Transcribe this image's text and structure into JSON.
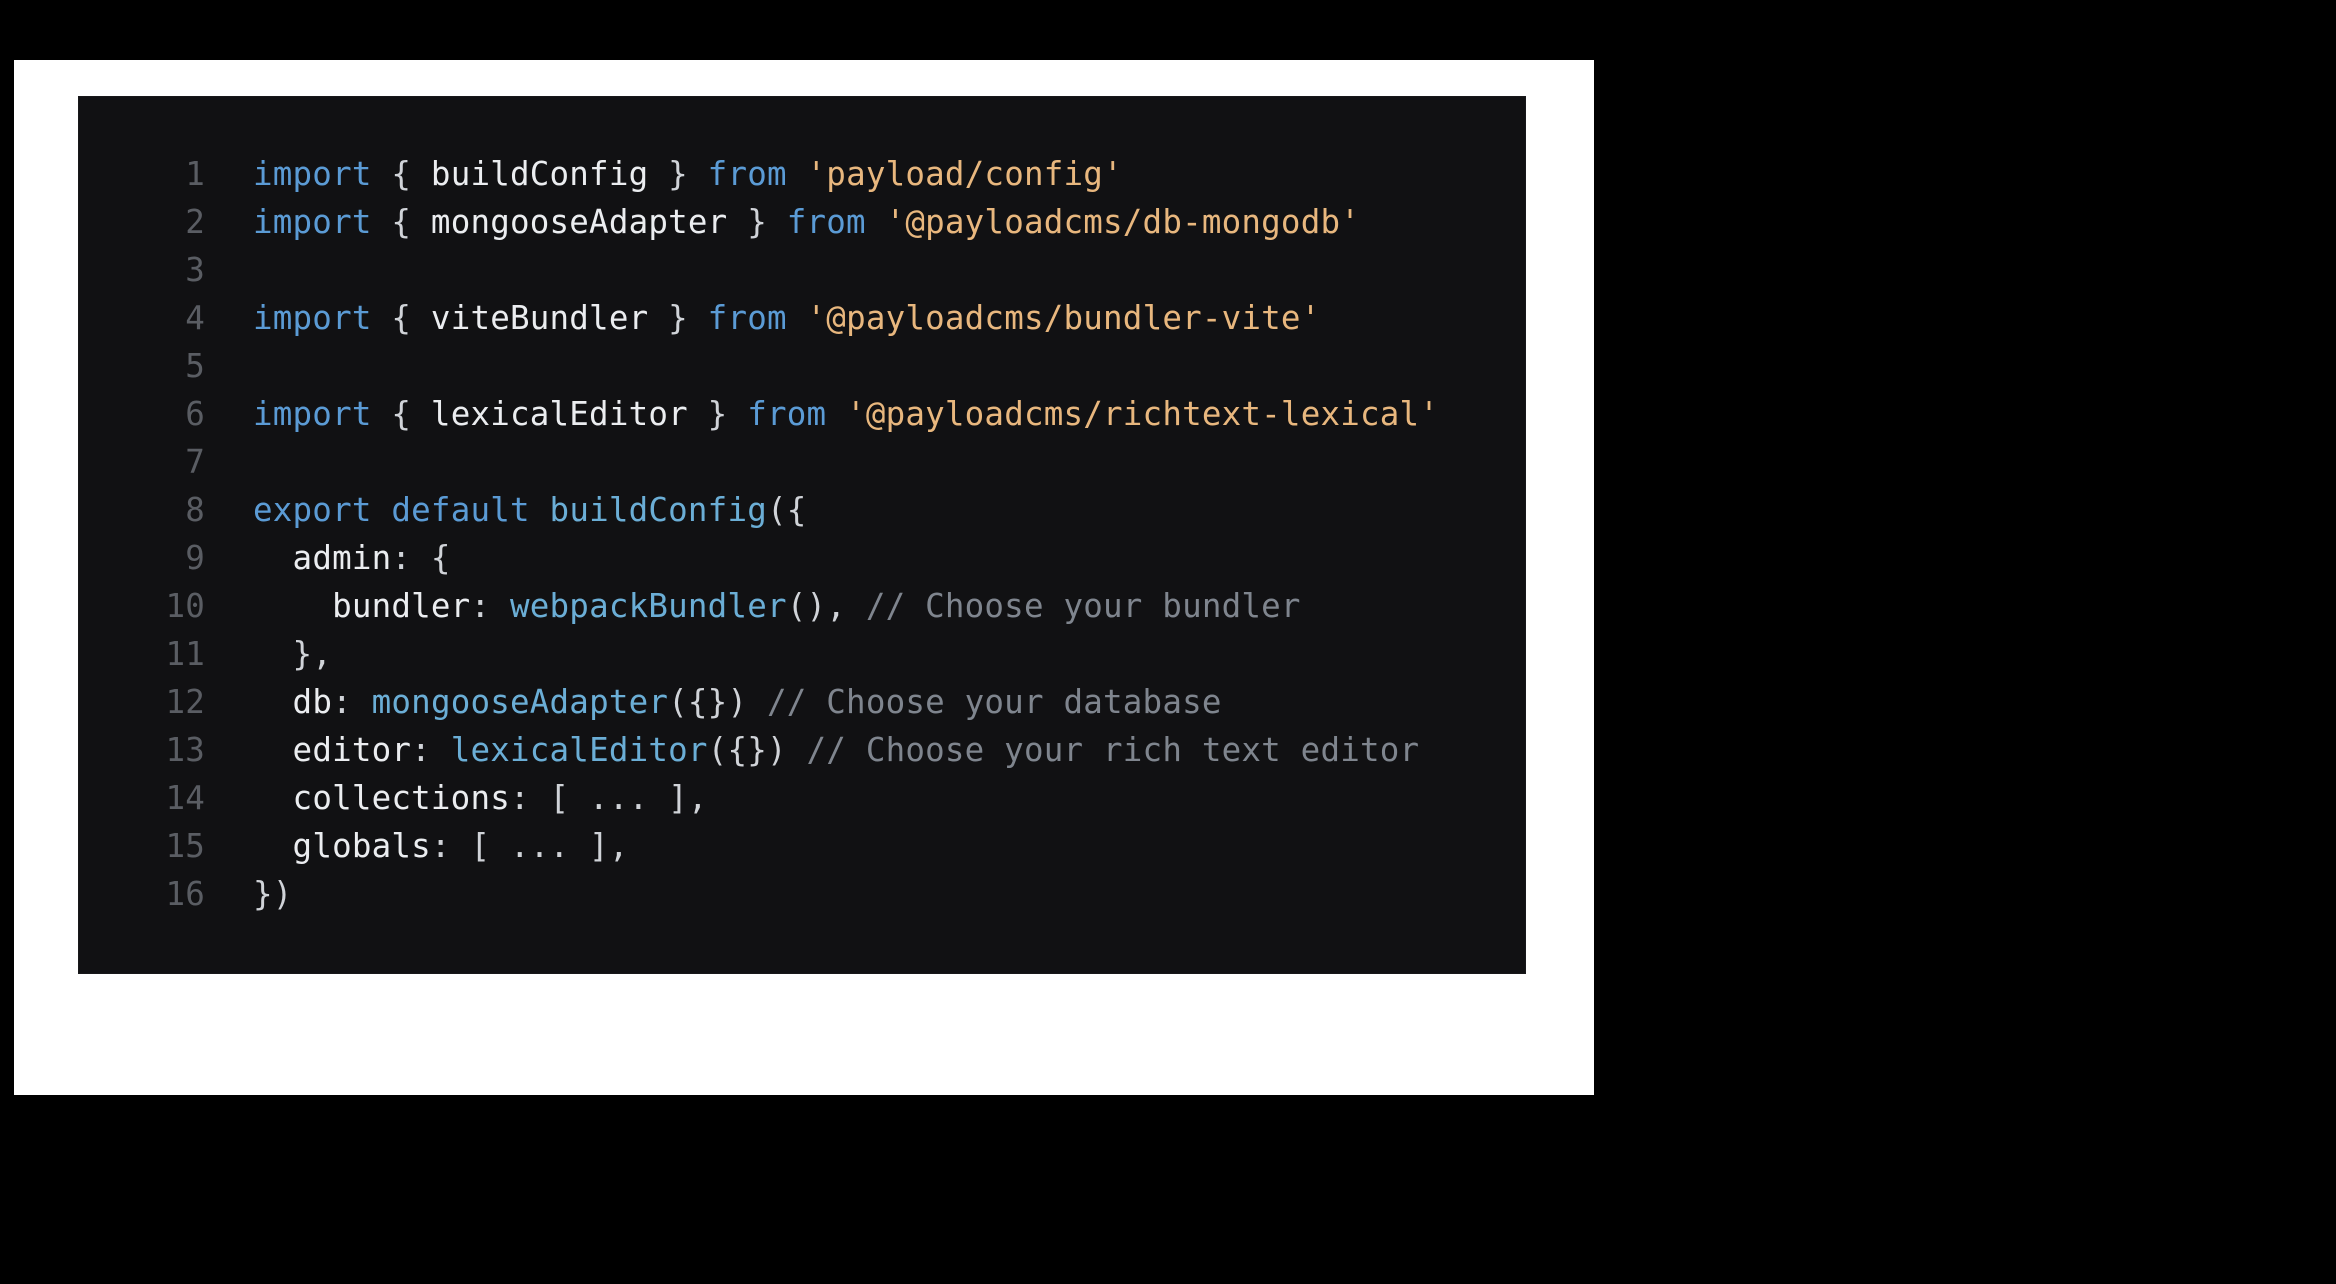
{
  "code": {
    "lines": [
      {
        "num": "1",
        "tokens": [
          {
            "cls": "kw",
            "t": "import"
          },
          {
            "cls": "punc",
            "t": " { "
          },
          {
            "cls": "ident",
            "t": "buildConfig"
          },
          {
            "cls": "punc",
            "t": " } "
          },
          {
            "cls": "kw",
            "t": "from"
          },
          {
            "cls": "punc",
            "t": " "
          },
          {
            "cls": "str",
            "t": "'payload/config'"
          }
        ]
      },
      {
        "num": "2",
        "tokens": [
          {
            "cls": "kw",
            "t": "import"
          },
          {
            "cls": "punc",
            "t": " { "
          },
          {
            "cls": "ident",
            "t": "mongooseAdapter"
          },
          {
            "cls": "punc",
            "t": " } "
          },
          {
            "cls": "kw",
            "t": "from"
          },
          {
            "cls": "punc",
            "t": " "
          },
          {
            "cls": "str",
            "t": "'@payloadcms/db-mongodb'"
          }
        ]
      },
      {
        "num": "3",
        "tokens": []
      },
      {
        "num": "4",
        "tokens": [
          {
            "cls": "kw",
            "t": "import"
          },
          {
            "cls": "punc",
            "t": " { "
          },
          {
            "cls": "ident",
            "t": "viteBundler"
          },
          {
            "cls": "punc",
            "t": " } "
          },
          {
            "cls": "kw",
            "t": "from"
          },
          {
            "cls": "punc",
            "t": " "
          },
          {
            "cls": "str",
            "t": "'@payloadcms/bundler-vite'"
          }
        ]
      },
      {
        "num": "5",
        "tokens": []
      },
      {
        "num": "6",
        "tokens": [
          {
            "cls": "kw",
            "t": "import"
          },
          {
            "cls": "punc",
            "t": " { "
          },
          {
            "cls": "ident",
            "t": "lexicalEditor"
          },
          {
            "cls": "punc",
            "t": " } "
          },
          {
            "cls": "kw",
            "t": "from"
          },
          {
            "cls": "punc",
            "t": " "
          },
          {
            "cls": "str",
            "t": "'@payloadcms/richtext-lexical'"
          }
        ]
      },
      {
        "num": "7",
        "tokens": []
      },
      {
        "num": "8",
        "tokens": [
          {
            "cls": "kw",
            "t": "export"
          },
          {
            "cls": "punc",
            "t": " "
          },
          {
            "cls": "kw",
            "t": "default"
          },
          {
            "cls": "punc",
            "t": " "
          },
          {
            "cls": "call",
            "t": "buildConfig"
          },
          {
            "cls": "punc",
            "t": "({"
          }
        ]
      },
      {
        "num": "9",
        "tokens": [
          {
            "cls": "punc",
            "t": "  "
          },
          {
            "cls": "ident",
            "t": "admin"
          },
          {
            "cls": "punc",
            "t": ": {"
          }
        ]
      },
      {
        "num": "10",
        "tokens": [
          {
            "cls": "punc",
            "t": "    "
          },
          {
            "cls": "ident",
            "t": "bundler"
          },
          {
            "cls": "punc",
            "t": ": "
          },
          {
            "cls": "call",
            "t": "webpackBundler"
          },
          {
            "cls": "punc",
            "t": "(), "
          },
          {
            "cls": "cmt",
            "t": "// Choose your bundler"
          }
        ]
      },
      {
        "num": "11",
        "tokens": [
          {
            "cls": "punc",
            "t": "  },"
          }
        ]
      },
      {
        "num": "12",
        "tokens": [
          {
            "cls": "punc",
            "t": "  "
          },
          {
            "cls": "ident",
            "t": "db"
          },
          {
            "cls": "punc",
            "t": ": "
          },
          {
            "cls": "call",
            "t": "mongooseAdapter"
          },
          {
            "cls": "punc",
            "t": "({}) "
          },
          {
            "cls": "cmt",
            "t": "// Choose your database"
          }
        ]
      },
      {
        "num": "13",
        "tokens": [
          {
            "cls": "punc",
            "t": "  "
          },
          {
            "cls": "ident",
            "t": "editor"
          },
          {
            "cls": "punc",
            "t": ": "
          },
          {
            "cls": "call",
            "t": "lexicalEditor"
          },
          {
            "cls": "punc",
            "t": "({}) "
          },
          {
            "cls": "cmt",
            "t": "// Choose your rich text editor"
          }
        ]
      },
      {
        "num": "14",
        "tokens": [
          {
            "cls": "punc",
            "t": "  "
          },
          {
            "cls": "ident",
            "t": "collections"
          },
          {
            "cls": "punc",
            "t": ": [ ... ],"
          }
        ]
      },
      {
        "num": "15",
        "tokens": [
          {
            "cls": "punc",
            "t": "  "
          },
          {
            "cls": "ident",
            "t": "globals"
          },
          {
            "cls": "punc",
            "t": ": [ ... ],"
          }
        ]
      },
      {
        "num": "16",
        "tokens": [
          {
            "cls": "punc",
            "t": "})"
          }
        ]
      }
    ]
  }
}
